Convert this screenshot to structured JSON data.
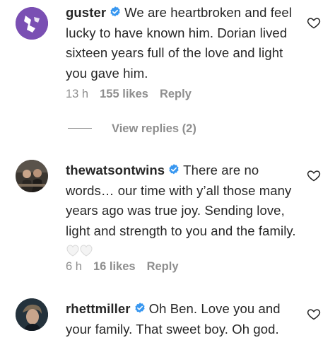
{
  "comments": [
    {
      "username": "guster",
      "text": "We are heartbroken and feel lucky to have known him. Dorian lived sixteen years full of the love and light you gave him.",
      "time": "13 h",
      "likes": "155 likes",
      "reply": "Reply",
      "view_replies": "View replies (2)"
    },
    {
      "username": "thewatsontwins",
      "text": "There are no words… our time with y’all those many years ago was true joy. Sending love, light and strength to you and the family.",
      "time": "6 h",
      "likes": "16 likes",
      "reply": "Reply"
    },
    {
      "username": "rhettmiller",
      "text": "Oh Ben. Love you and your family. That sweet boy. Oh god."
    }
  ],
  "colors": {
    "verified": "#3897f0",
    "muted_text": "#8e8e8e",
    "primary_text": "#262626"
  },
  "icons": {
    "like": "heart-outline-icon",
    "verified": "verified-badge-icon",
    "emoji": "white-heart-emoji"
  }
}
